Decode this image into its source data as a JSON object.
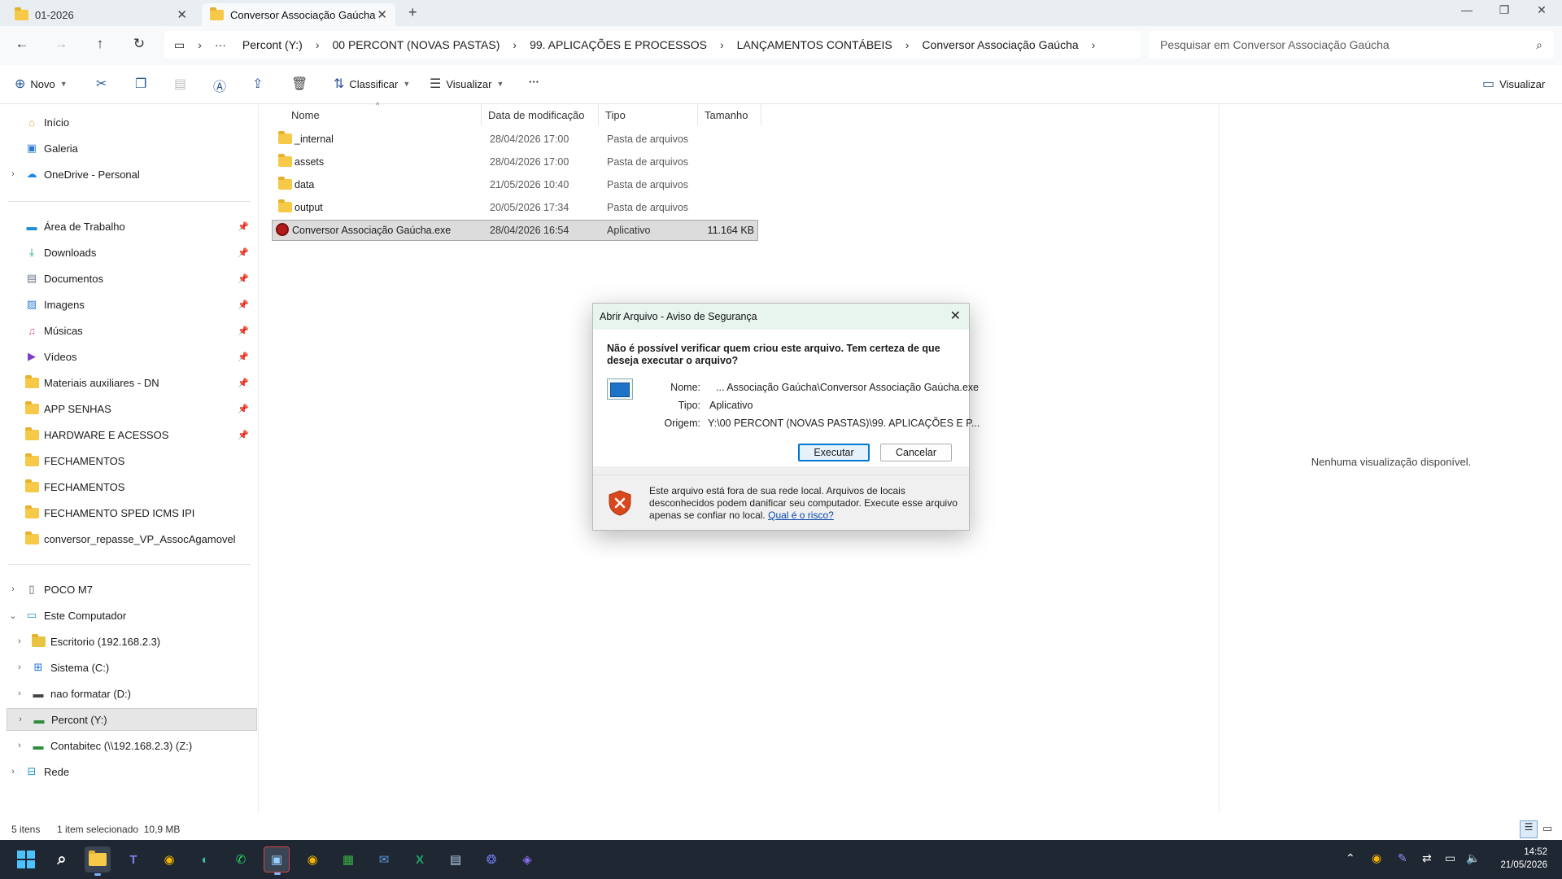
{
  "tabs": [
    {
      "label": "01-2026",
      "active": false
    },
    {
      "label": "Conversor Associação Gaúcha",
      "active": true
    }
  ],
  "nav": {
    "more_label": "···"
  },
  "breadcrumb": [
    "Percont (Y:)",
    "00 PERCONT (NOVAS PASTAS)",
    "99. APLICAÇÕES E PROCESSOS",
    "LANÇAMENTOS CONTÁBEIS",
    "Conversor Associação Gaúcha"
  ],
  "search": {
    "placeholder": "Pesquisar em Conversor Associação Gaúcha"
  },
  "toolbar": {
    "new_label": "Novo",
    "sort_label": "Classificar",
    "view_label": "Visualizar",
    "more_label": "···",
    "preview_label": "Visualizar"
  },
  "sidebar": {
    "top": [
      {
        "label": "Início"
      },
      {
        "label": "Galeria"
      },
      {
        "label": "OneDrive - Personal"
      }
    ],
    "quick": [
      {
        "label": "Área de Trabalho"
      },
      {
        "label": "Downloads"
      },
      {
        "label": "Documentos"
      },
      {
        "label": "Imagens"
      },
      {
        "label": "Músicas"
      },
      {
        "label": "Vídeos"
      },
      {
        "label": "Materiais auxiliares - DN"
      },
      {
        "label": "APP SENHAS"
      },
      {
        "label": "HARDWARE E ACESSOS"
      },
      {
        "label": "FECHAMENTOS"
      },
      {
        "label": "FECHAMENTOS"
      },
      {
        "label": "FECHAMENTO SPED ICMS IPI"
      },
      {
        "label": "conversor_repasse_VP_AssocAgamovel"
      }
    ],
    "devices": [
      {
        "label": "POCO M7"
      },
      {
        "label": "Este Computador"
      },
      {
        "label": "Escritorio (192.168.2.3)"
      },
      {
        "label": "Sistema (C:)"
      },
      {
        "label": "nao formatar (D:)"
      },
      {
        "label": "Percont (Y:)"
      },
      {
        "label": "Contabitec (\\\\192.168.2.3) (Z:)"
      },
      {
        "label": "Rede"
      }
    ]
  },
  "columns": {
    "name": "Nome",
    "date": "Data de modificação",
    "type": "Tipo",
    "size": "Tamanho"
  },
  "files": [
    {
      "name": "_internal",
      "date": "28/04/2026 17:00",
      "type": "Pasta de arquivos",
      "size": ""
    },
    {
      "name": "assets",
      "date": "28/04/2026 17:00",
      "type": "Pasta de arquivos",
      "size": ""
    },
    {
      "name": "data",
      "date": "21/05/2026 10:40",
      "type": "Pasta de arquivos",
      "size": ""
    },
    {
      "name": "output",
      "date": "20/05/2026 17:34",
      "type": "Pasta de arquivos",
      "size": ""
    },
    {
      "name": "Conversor Associação Gaúcha.exe",
      "date": "28/04/2026 16:54",
      "type": "Aplicativo",
      "size": "11.164 KB"
    }
  ],
  "preview": {
    "message": "Nenhuma visualização disponível."
  },
  "status": {
    "count": "5 itens",
    "selection": "1 item selecionado  10,9 MB"
  },
  "dialog": {
    "title": "Abrir Arquivo - Aviso de Segurança",
    "question": "Não é possível verificar quem criou este arquivo. Tem certeza de que deseja executar o arquivo?",
    "name_label": "Nome:",
    "name_value": "... Associação Gaúcha\\Conversor Associação Gaúcha.exe",
    "type_label": "Tipo:",
    "type_value": "Aplicativo",
    "origin_label": "Origem:",
    "origin_value": "Y:\\00 PERCONT (NOVAS PASTAS)\\99. APLICAÇÕES E P...",
    "run_label": "Executar",
    "cancel_label": "Cancelar",
    "warning": "Este arquivo está fora de sua rede local. Arquivos de locais desconhecidos podem danificar seu computador. Execute esse arquivo apenas se confiar no local.",
    "risk_link": "Qual é o risco?"
  },
  "clock": {
    "time": "14:52",
    "date": "21/05/2026"
  },
  "colors": {
    "accent": "#0078d7",
    "folder": "#f7c948",
    "taskbar": "#1f2733",
    "dialog_title": "#e8f5ef",
    "shield": "#d9481c"
  }
}
